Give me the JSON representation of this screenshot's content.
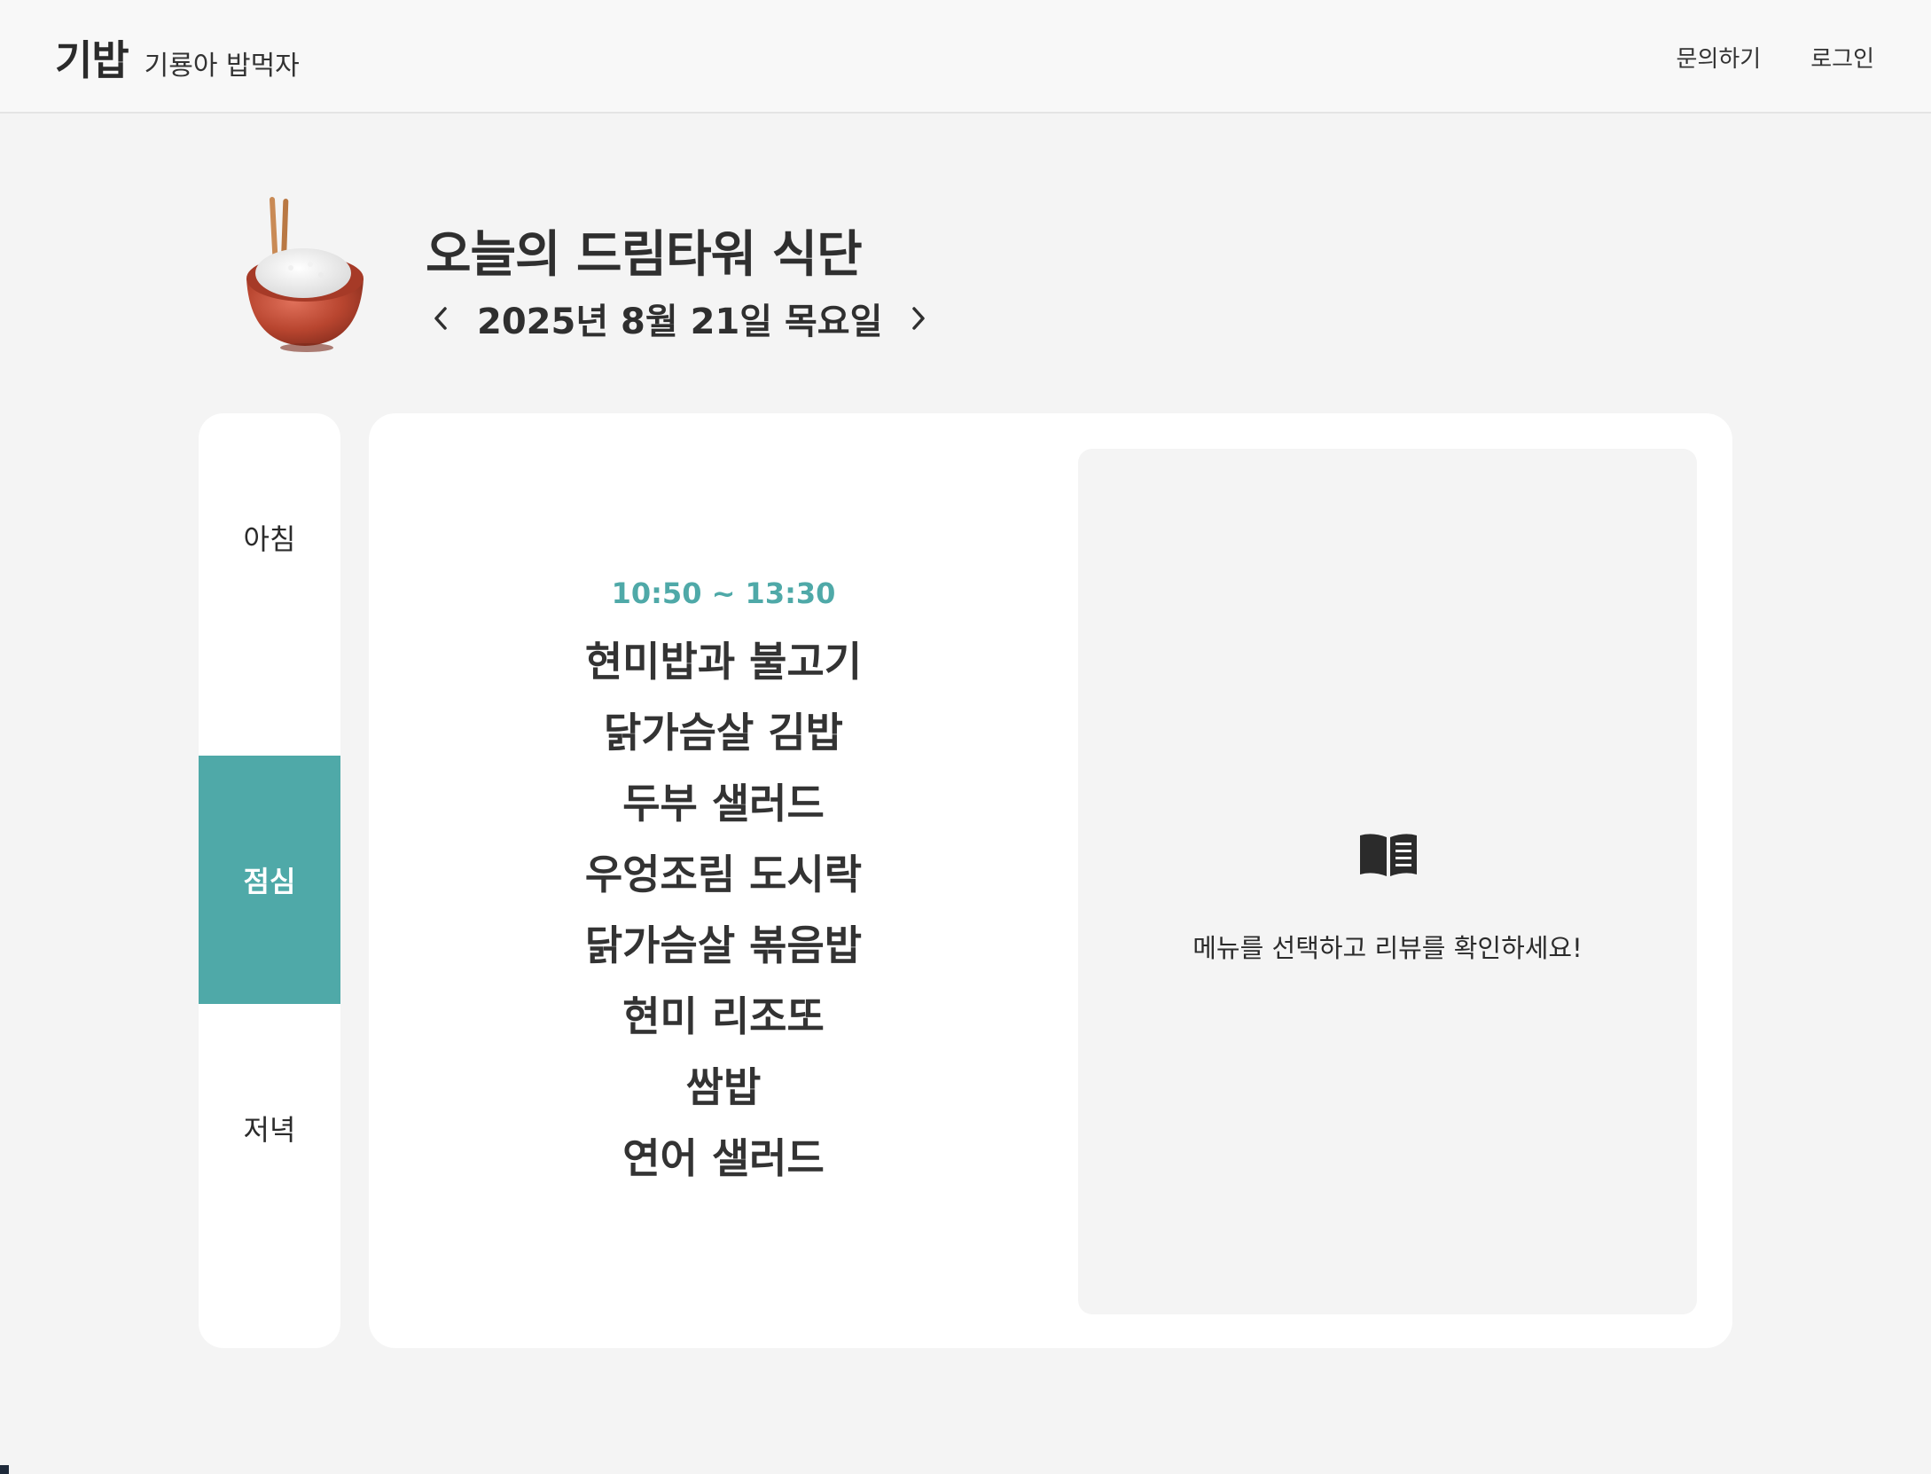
{
  "header": {
    "brand_title": "기밥",
    "brand_subtitle": "기룡아 밥먹자",
    "nav": {
      "contact": "문의하기",
      "login": "로그인"
    }
  },
  "hero": {
    "title": "오늘의 드림타워 식단",
    "date": "2025년 8월 21일 목요일",
    "logo_icon": "rice-bowl-with-chopsticks-icon"
  },
  "meals": {
    "tabs": [
      {
        "label": "아침",
        "active": false
      },
      {
        "label": "점심",
        "active": true
      },
      {
        "label": "저녁",
        "active": false
      }
    ]
  },
  "menu": {
    "time": "10:50 ~ 13:30",
    "items": [
      "현미밥과 불고기",
      "닭가슴살 김밥",
      "두부 샐러드",
      "우엉조림 도시락",
      "닭가슴살 볶음밥",
      "현미 리조또",
      "쌈밥",
      "연어 샐러드"
    ]
  },
  "review": {
    "icon": "open-book-icon",
    "message": "메뉴를 선택하고 리뷰를 확인하세요!"
  },
  "colors": {
    "accent": "#4fa9a8",
    "background": "#f4f4f4",
    "card": "#ffffff",
    "text": "#2b2b2b"
  }
}
